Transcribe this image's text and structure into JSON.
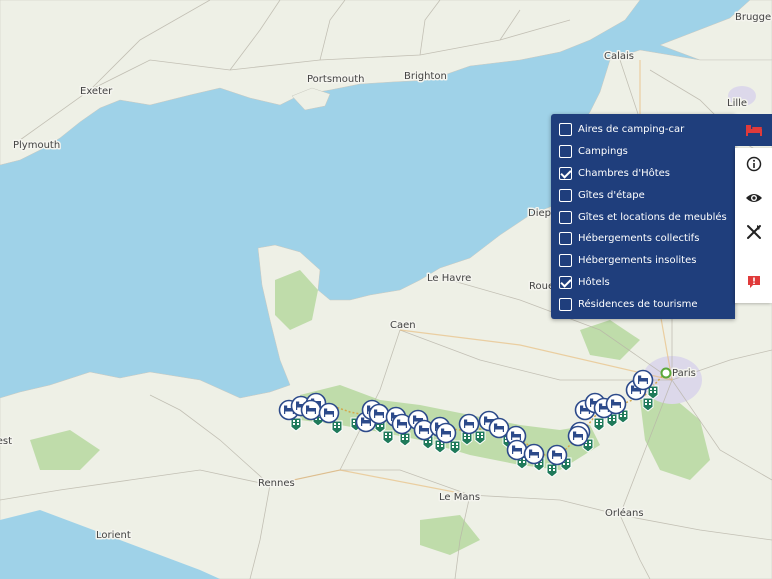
{
  "map": {
    "cities": [
      {
        "name": "Brugge"
      },
      {
        "name": "Calais"
      },
      {
        "name": "Lille"
      },
      {
        "name": "Portsmouth"
      },
      {
        "name": "Brighton"
      },
      {
        "name": "Exeter"
      },
      {
        "name": "Plymouth"
      },
      {
        "name": "Dieppe"
      },
      {
        "name": "Le Havre"
      },
      {
        "name": "Rouen"
      },
      {
        "name": "Caen"
      },
      {
        "name": "Paris"
      },
      {
        "name": "Rennes"
      },
      {
        "name": "Le Mans"
      },
      {
        "name": "Orléans"
      },
      {
        "name": "Lorient"
      },
      {
        "name": "Brest"
      }
    ],
    "marker_icon": "bed-icon",
    "poi_icon": "hotel-building-icon",
    "colors": {
      "sea": "#9fd2e8",
      "land": "#eef0e6",
      "forest": "#b9d9a3",
      "urban": "#dcd8ea",
      "marker_ring": "#2c4a8a",
      "poi_green": "#1f7a5a",
      "panel_bg": "#1f3e7c"
    }
  },
  "filters": {
    "items": [
      {
        "label": "Aires de camping-car",
        "checked": false
      },
      {
        "label": "Campings",
        "checked": false
      },
      {
        "label": "Chambres d'Hôtes",
        "checked": true
      },
      {
        "label": "Gîtes d'étape",
        "checked": false
      },
      {
        "label": "Gîtes et locations de meublés",
        "checked": false
      },
      {
        "label": "Hébergements collectifs",
        "checked": false
      },
      {
        "label": "Hébergements insolites",
        "checked": false
      },
      {
        "label": "Hôtels",
        "checked": true
      },
      {
        "label": "Résidences de tourisme",
        "checked": false
      }
    ]
  },
  "toolbar": {
    "buttons": [
      {
        "icon": "bed-icon",
        "active": true
      },
      {
        "icon": "info-icon",
        "active": false
      },
      {
        "icon": "eye-icon",
        "active": false
      },
      {
        "icon": "fork-knife-icon",
        "active": false
      },
      {
        "icon": "alert-icon",
        "active": false
      }
    ]
  }
}
